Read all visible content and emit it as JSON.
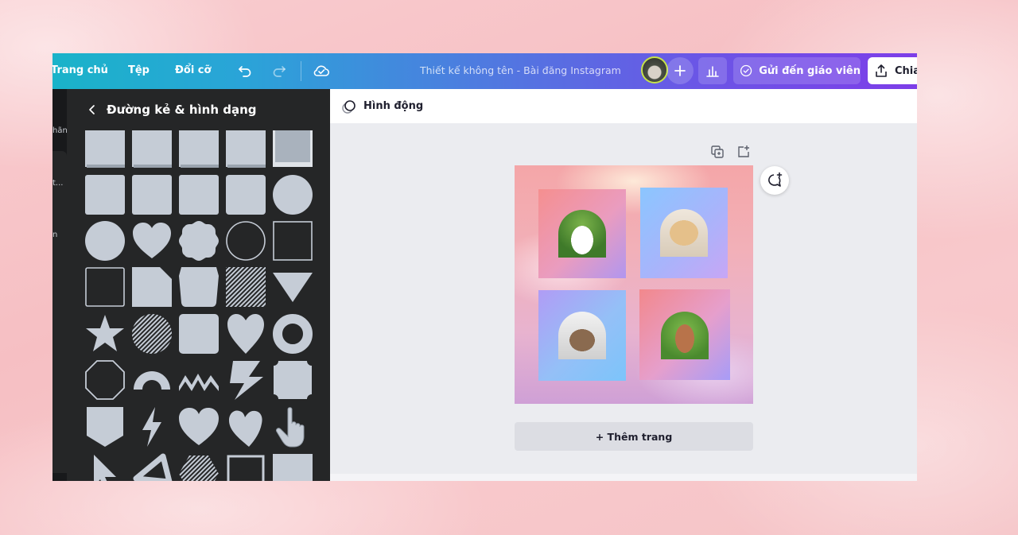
{
  "topbar": {
    "menu": [
      "Trang chủ",
      "Tệp",
      "Đổi cỡ"
    ],
    "doc_title": "Thiết kế không tên - Bài đăng Instagram",
    "teacher_label": "Gửi đến giáo viên",
    "share_label": "Chia"
  },
  "rail": {
    "items": [
      "hãn",
      "t...",
      "n"
    ]
  },
  "panel": {
    "title": "Đường kẻ & hình dạng"
  },
  "editor": {
    "animate_label": "Hình động",
    "add_page_label": "+ Thêm trang"
  },
  "colors": {
    "shape_fill": "#c5ccd6",
    "panel_bg": "#252627",
    "editor_bg": "#ebecf0"
  }
}
